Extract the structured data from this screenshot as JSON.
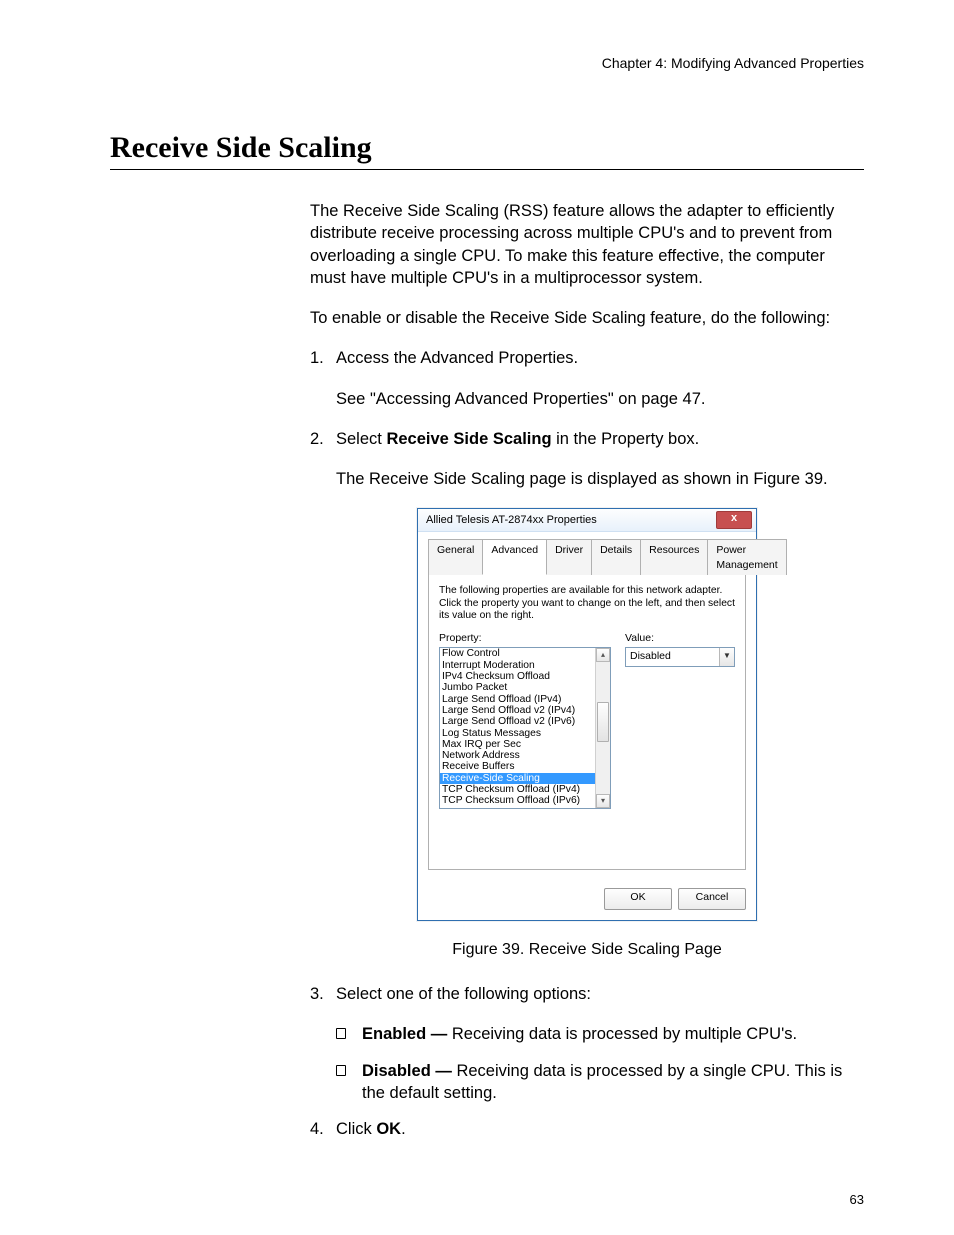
{
  "chapter": "Chapter 4: Modifying Advanced Properties",
  "section_title": "Receive Side Scaling",
  "intro_para": "The Receive Side Scaling (RSS) feature allows the adapter to efficiently distribute receive processing across multiple CPU's and to prevent from overloading a single CPU. To make this feature effective, the computer must have multiple CPU's in a multiprocessor system.",
  "lead_para": "To enable or disable the Receive Side Scaling feature, do the following:",
  "steps": {
    "s1_num": "1.",
    "s1_l1": "Access the Advanced Properties.",
    "s1_l2": "See \"Accessing Advanced Properties\" on page 47.",
    "s2_num": "2.",
    "s2_l1_a": "Select ",
    "s2_l1_b": "Receive Side Scaling",
    "s2_l1_c": " in the Property box.",
    "s2_l2": "The Receive Side Scaling page is displayed as shown in Figure 39.",
    "s3_num": "3.",
    "s3_l1": "Select one of the following options:",
    "s3_opt1_a": "Enabled —",
    "s3_opt1_b": " Receiving data is processed by multiple CPU's.",
    "s3_opt2_a": "Disabled —",
    "s3_opt2_b": " Receiving data is processed by a single CPU. This is the default setting.",
    "s4_num": "4.",
    "s4_a": "Click ",
    "s4_b": "OK",
    "s4_c": "."
  },
  "figure_caption": "Figure 39. Receive Side Scaling Page",
  "page_number": "63",
  "dialog": {
    "title": "Allied Telesis AT-2874xx Properties",
    "close": "x",
    "tabs": [
      "General",
      "Advanced",
      "Driver",
      "Details",
      "Resources",
      "Power Management"
    ],
    "active_tab_index": 1,
    "description": "The following properties are available for this network adapter. Click the property you want to change on the left, and then select its value on the right.",
    "property_label": "Property:",
    "value_label": "Value:",
    "property_list": [
      "Flow Control",
      "Interrupt Moderation",
      "IPv4 Checksum Offload",
      "Jumbo Packet",
      "Large Send Offload (IPv4)",
      "Large Send Offload v2 (IPv4)",
      "Large Send Offload v2 (IPv6)",
      "Log Status Messages",
      "Max IRQ per Sec",
      "Network Address",
      "Receive Buffers",
      "Receive-Side Scaling",
      "TCP Checksum Offload (IPv4)",
      "TCP Checksum Offload (IPv6)"
    ],
    "selected_property_index": 11,
    "value_selected": "Disabled",
    "ok": "OK",
    "cancel": "Cancel"
  }
}
